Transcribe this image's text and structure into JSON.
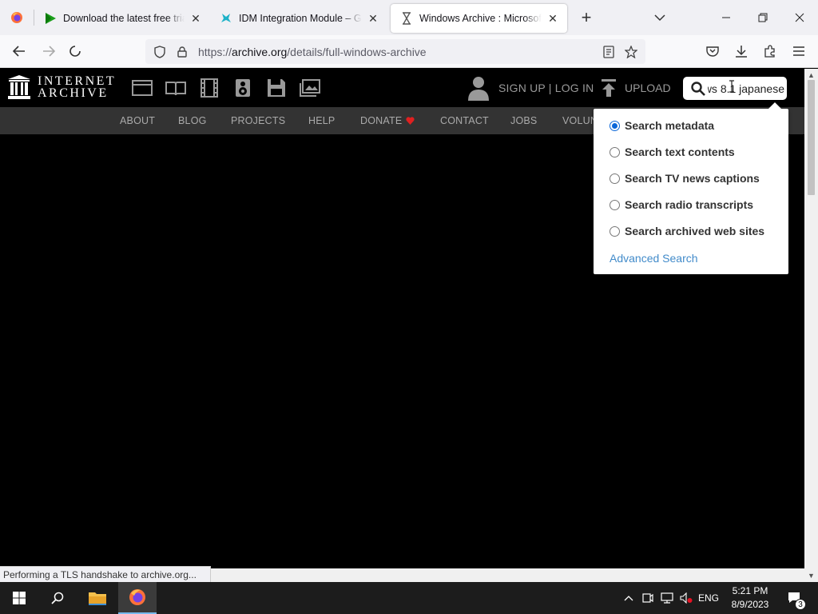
{
  "browser": {
    "tabs": [
      {
        "title": "Download the latest free trial ve",
        "favicon": "play-arrow-icon",
        "active": false
      },
      {
        "title": "IDM Integration Module – Get th",
        "favicon": "puzzle-icon",
        "active": false
      },
      {
        "title": "Windows Archive : Microsoft : F",
        "favicon": "hourglass-icon",
        "active": true
      }
    ],
    "url_prefix": "https://",
    "url_host": "archive.org",
    "url_path": "/details/full-windows-archive"
  },
  "ia": {
    "logo_line1": "INTERNET",
    "logo_line2": "ARCHIVE",
    "media_icons": [
      "web-icon",
      "texts-icon",
      "video-icon",
      "audio-icon",
      "software-icon",
      "images-icon"
    ],
    "signup_login": "SIGN UP | LOG IN",
    "upload": "UPLOAD",
    "search_value": "ws 8.1 japanese",
    "nav": [
      "ABOUT",
      "BLOG",
      "PROJECTS",
      "HELP",
      "DONATE",
      "CONTACT",
      "JOBS",
      "VOLUN"
    ],
    "donate_heart_color": "#e02020"
  },
  "search_dropdown": {
    "options": [
      {
        "label": "Search metadata",
        "checked": true
      },
      {
        "label": "Search text contents",
        "checked": false
      },
      {
        "label": "Search TV news captions",
        "checked": false
      },
      {
        "label": "Search radio transcripts",
        "checked": false
      },
      {
        "label": "Search archived web sites",
        "checked": false
      }
    ],
    "advanced": "Advanced Search"
  },
  "status_bar": "Performing a TLS handshake to archive.org...",
  "taskbar": {
    "lang": "ENG",
    "time": "5:21 PM",
    "date": "8/9/2023",
    "notifications": "3"
  },
  "colors": {
    "accent_blue": "#0a66d8",
    "link_blue": "#428bca",
    "ia_black": "#000000",
    "ia_subnav": "#333333"
  }
}
